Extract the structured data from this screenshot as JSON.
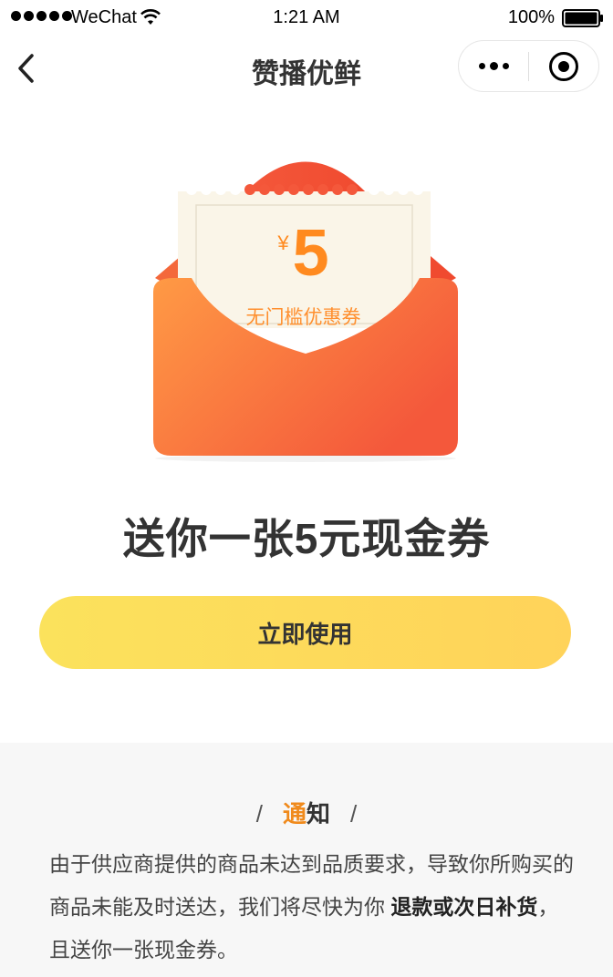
{
  "status_bar": {
    "carrier": "WeChat",
    "time": "1:21 AM",
    "battery": "100%"
  },
  "nav": {
    "title": "赞播优鲜"
  },
  "coupon": {
    "currency": "¥",
    "amount": "5",
    "description": "无门槛优惠券"
  },
  "headline": "送你一张5元现金券",
  "button": {
    "label": "立即使用"
  },
  "notice": {
    "title_highlight": "通",
    "title_rest": "知",
    "body_part1": "由于供应商提供的商品未达到品质要求，导致你所购买的商品未能及时送达，我们将尽快为你 ",
    "body_bold": "退款或次日补货",
    "body_part2": "，且送你一张现金券。"
  },
  "colors": {
    "accent_orange": "#ff8a1f",
    "button_yellow": "#fbe25c",
    "envelope_red": "#f4583b"
  }
}
